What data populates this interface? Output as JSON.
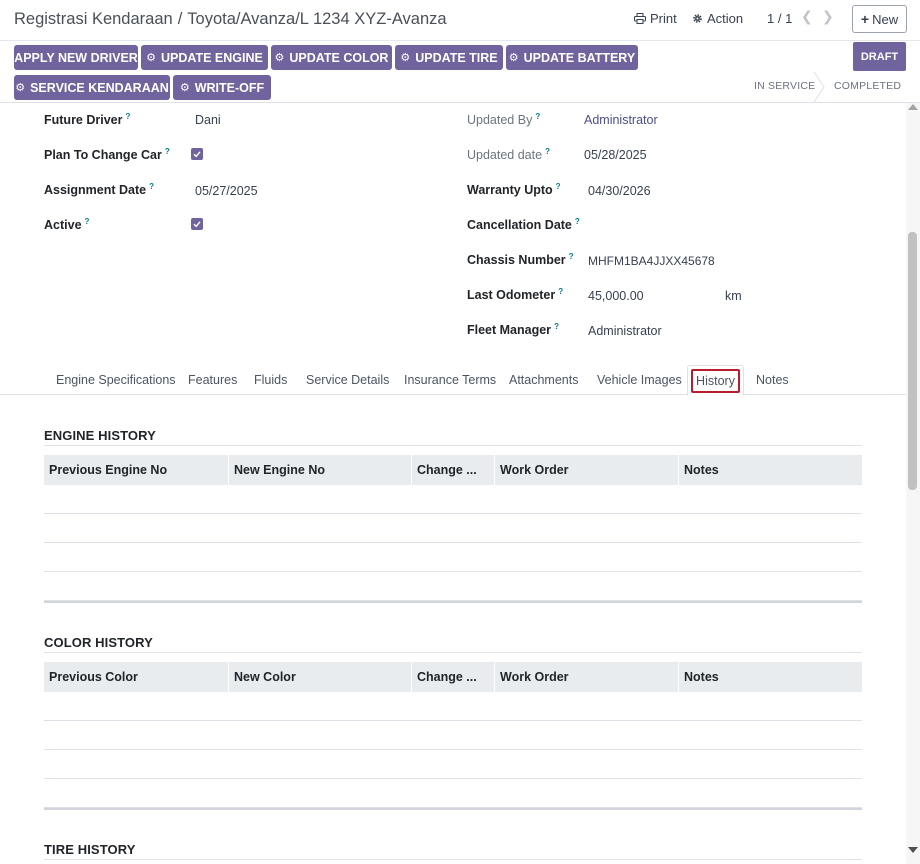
{
  "breadcrumb": {
    "parent": "Registrasi Kendaraan",
    "separator": "/",
    "current": "Toyota/Avanza/L 1234 XYZ-Avanza"
  },
  "toolbar": {
    "print_label": "Print",
    "action_label": "Action",
    "pager": "1 / 1",
    "new_label": "New"
  },
  "header_buttons": [
    {
      "label": "APPLY NEW DRIVER"
    },
    {
      "label": "UPDATE ENGINE"
    },
    {
      "label": "UPDATE COLOR"
    },
    {
      "label": "UPDATE TIRE"
    },
    {
      "label": "UPDATE BATTERY"
    },
    {
      "label": "SERVICE KENDARAAN"
    },
    {
      "label": "WRITE-OFF"
    }
  ],
  "statusbar": {
    "states": [
      "DRAFT",
      "IN SERVICE",
      "COMPLETED"
    ],
    "active": "DRAFT"
  },
  "fields_left": [
    {
      "label": "Future Driver",
      "value": "Dani"
    },
    {
      "label": "Plan To Change Car",
      "checked": true
    },
    {
      "label": "Assignment Date",
      "value": "05/27/2025"
    },
    {
      "label": "Active",
      "checked": true
    }
  ],
  "fields_right": [
    {
      "label": "Updated By",
      "value": "Administrator"
    },
    {
      "label": "Updated date",
      "value": "05/28/2025"
    },
    {
      "label": "Warranty Upto",
      "value": "04/30/2026"
    },
    {
      "label": "Cancellation Date",
      "value": ""
    },
    {
      "label": "Chassis Number",
      "value": "MHFM1BA4JJXX45678"
    },
    {
      "label": "Last Odometer",
      "value": "45,000.00",
      "unit": "km"
    },
    {
      "label": "Fleet Manager",
      "value": "Administrator"
    }
  ],
  "help_marker": "?",
  "tabs": [
    "Engine Specifications",
    "Features",
    "Fluids",
    "Service Details",
    "Insurance Terms",
    "Attachments",
    "Vehicle Images",
    "History",
    "Notes"
  ],
  "active_tab": "History",
  "history": {
    "engine": {
      "title": "ENGINE HISTORY",
      "columns": [
        "Previous Engine No",
        "New Engine No",
        "Change ...",
        "Work Order",
        "Notes"
      ]
    },
    "color": {
      "title": "COLOR HISTORY",
      "columns": [
        "Previous Color",
        "New Color",
        "Change ...",
        "Work Order",
        "Notes"
      ]
    },
    "tire": {
      "title": "TIRE HISTORY"
    }
  },
  "colors": {
    "primary": "#71639e",
    "highlight_border": "#b91c2c"
  }
}
